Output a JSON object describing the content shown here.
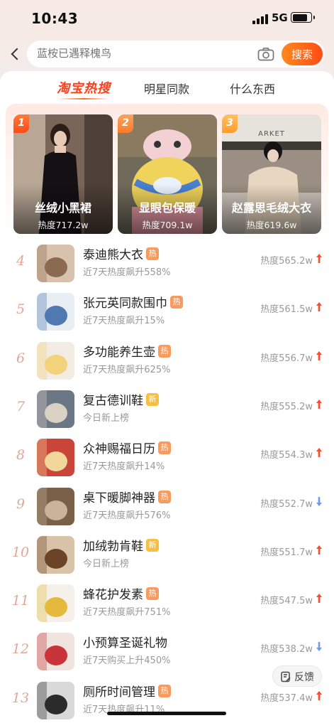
{
  "status_bar": {
    "time": "10:43",
    "network": "5G"
  },
  "search": {
    "placeholder": "蓝桉已遇释槐鸟",
    "button_label": "搜索"
  },
  "tabs": [
    {
      "label": "淘宝热搜",
      "active": true
    },
    {
      "label": "明星同款",
      "active": false
    },
    {
      "label": "什么东西",
      "active": false
    }
  ],
  "top3": [
    {
      "rank": "1",
      "name": "丝绒小黑裙",
      "heat": "热度717.2w"
    },
    {
      "rank": "2",
      "name": "显眼包保暖",
      "heat": "热度709.1w"
    },
    {
      "rank": "3",
      "name": "赵露思毛绒大衣",
      "heat": "热度619.6w",
      "image_text": "ARKET"
    }
  ],
  "list": [
    {
      "rank": "4",
      "title": "泰迪熊大衣",
      "tag": "热",
      "tag_type": "hot",
      "sub": "近7天热度飙升558%",
      "heat": "热度565.2w",
      "trend": "up"
    },
    {
      "rank": "5",
      "title": "张元英同款围巾",
      "tag": "热",
      "tag_type": "hot",
      "sub": "近7天热度飙升15%",
      "heat": "热度561.5w",
      "trend": "up"
    },
    {
      "rank": "6",
      "title": "多功能养生壶",
      "tag": "热",
      "tag_type": "hot",
      "sub": "近7天热度飙升625%",
      "heat": "热度556.7w",
      "trend": "up"
    },
    {
      "rank": "7",
      "title": "复古德训鞋",
      "tag": "新",
      "tag_type": "new",
      "sub": "今日新上榜",
      "heat": "热度555.2w",
      "trend": "up"
    },
    {
      "rank": "8",
      "title": "众神赐福日历",
      "tag": "热",
      "tag_type": "hot",
      "sub": "近7天热度飙升14%",
      "heat": "热度554.3w",
      "trend": "up"
    },
    {
      "rank": "9",
      "title": "桌下暖脚神器",
      "tag": "热",
      "tag_type": "hot",
      "sub": "近7天热度飙升576%",
      "heat": "热度552.7w",
      "trend": "down"
    },
    {
      "rank": "10",
      "title": "加绒勃肯鞋",
      "tag": "新",
      "tag_type": "new",
      "sub": "今日新上榜",
      "heat": "热度551.7w",
      "trend": "up"
    },
    {
      "rank": "11",
      "title": "蜂花护发素",
      "tag": "热",
      "tag_type": "hot",
      "sub": "近7天热度飙升751%",
      "heat": "热度547.5w",
      "trend": "up"
    },
    {
      "rank": "12",
      "title": "小预算圣诞礼物",
      "tag": "",
      "tag_type": "none",
      "sub": "近7天购买上升450%",
      "heat": "热度538.2w",
      "trend": "down"
    },
    {
      "rank": "13",
      "title": "厕所时间管理",
      "tag": "热",
      "tag_type": "hot",
      "sub": "近7天热度飙升11%",
      "heat": "热度537.4w",
      "trend": "up"
    }
  ],
  "feedback_label": "反馈",
  "colors": {
    "accent": "#ff4b14",
    "up": "#ff4b2b",
    "down": "#6a9cf5",
    "tag_hot": "#f99b5f",
    "tag_new": "#f7be40"
  }
}
